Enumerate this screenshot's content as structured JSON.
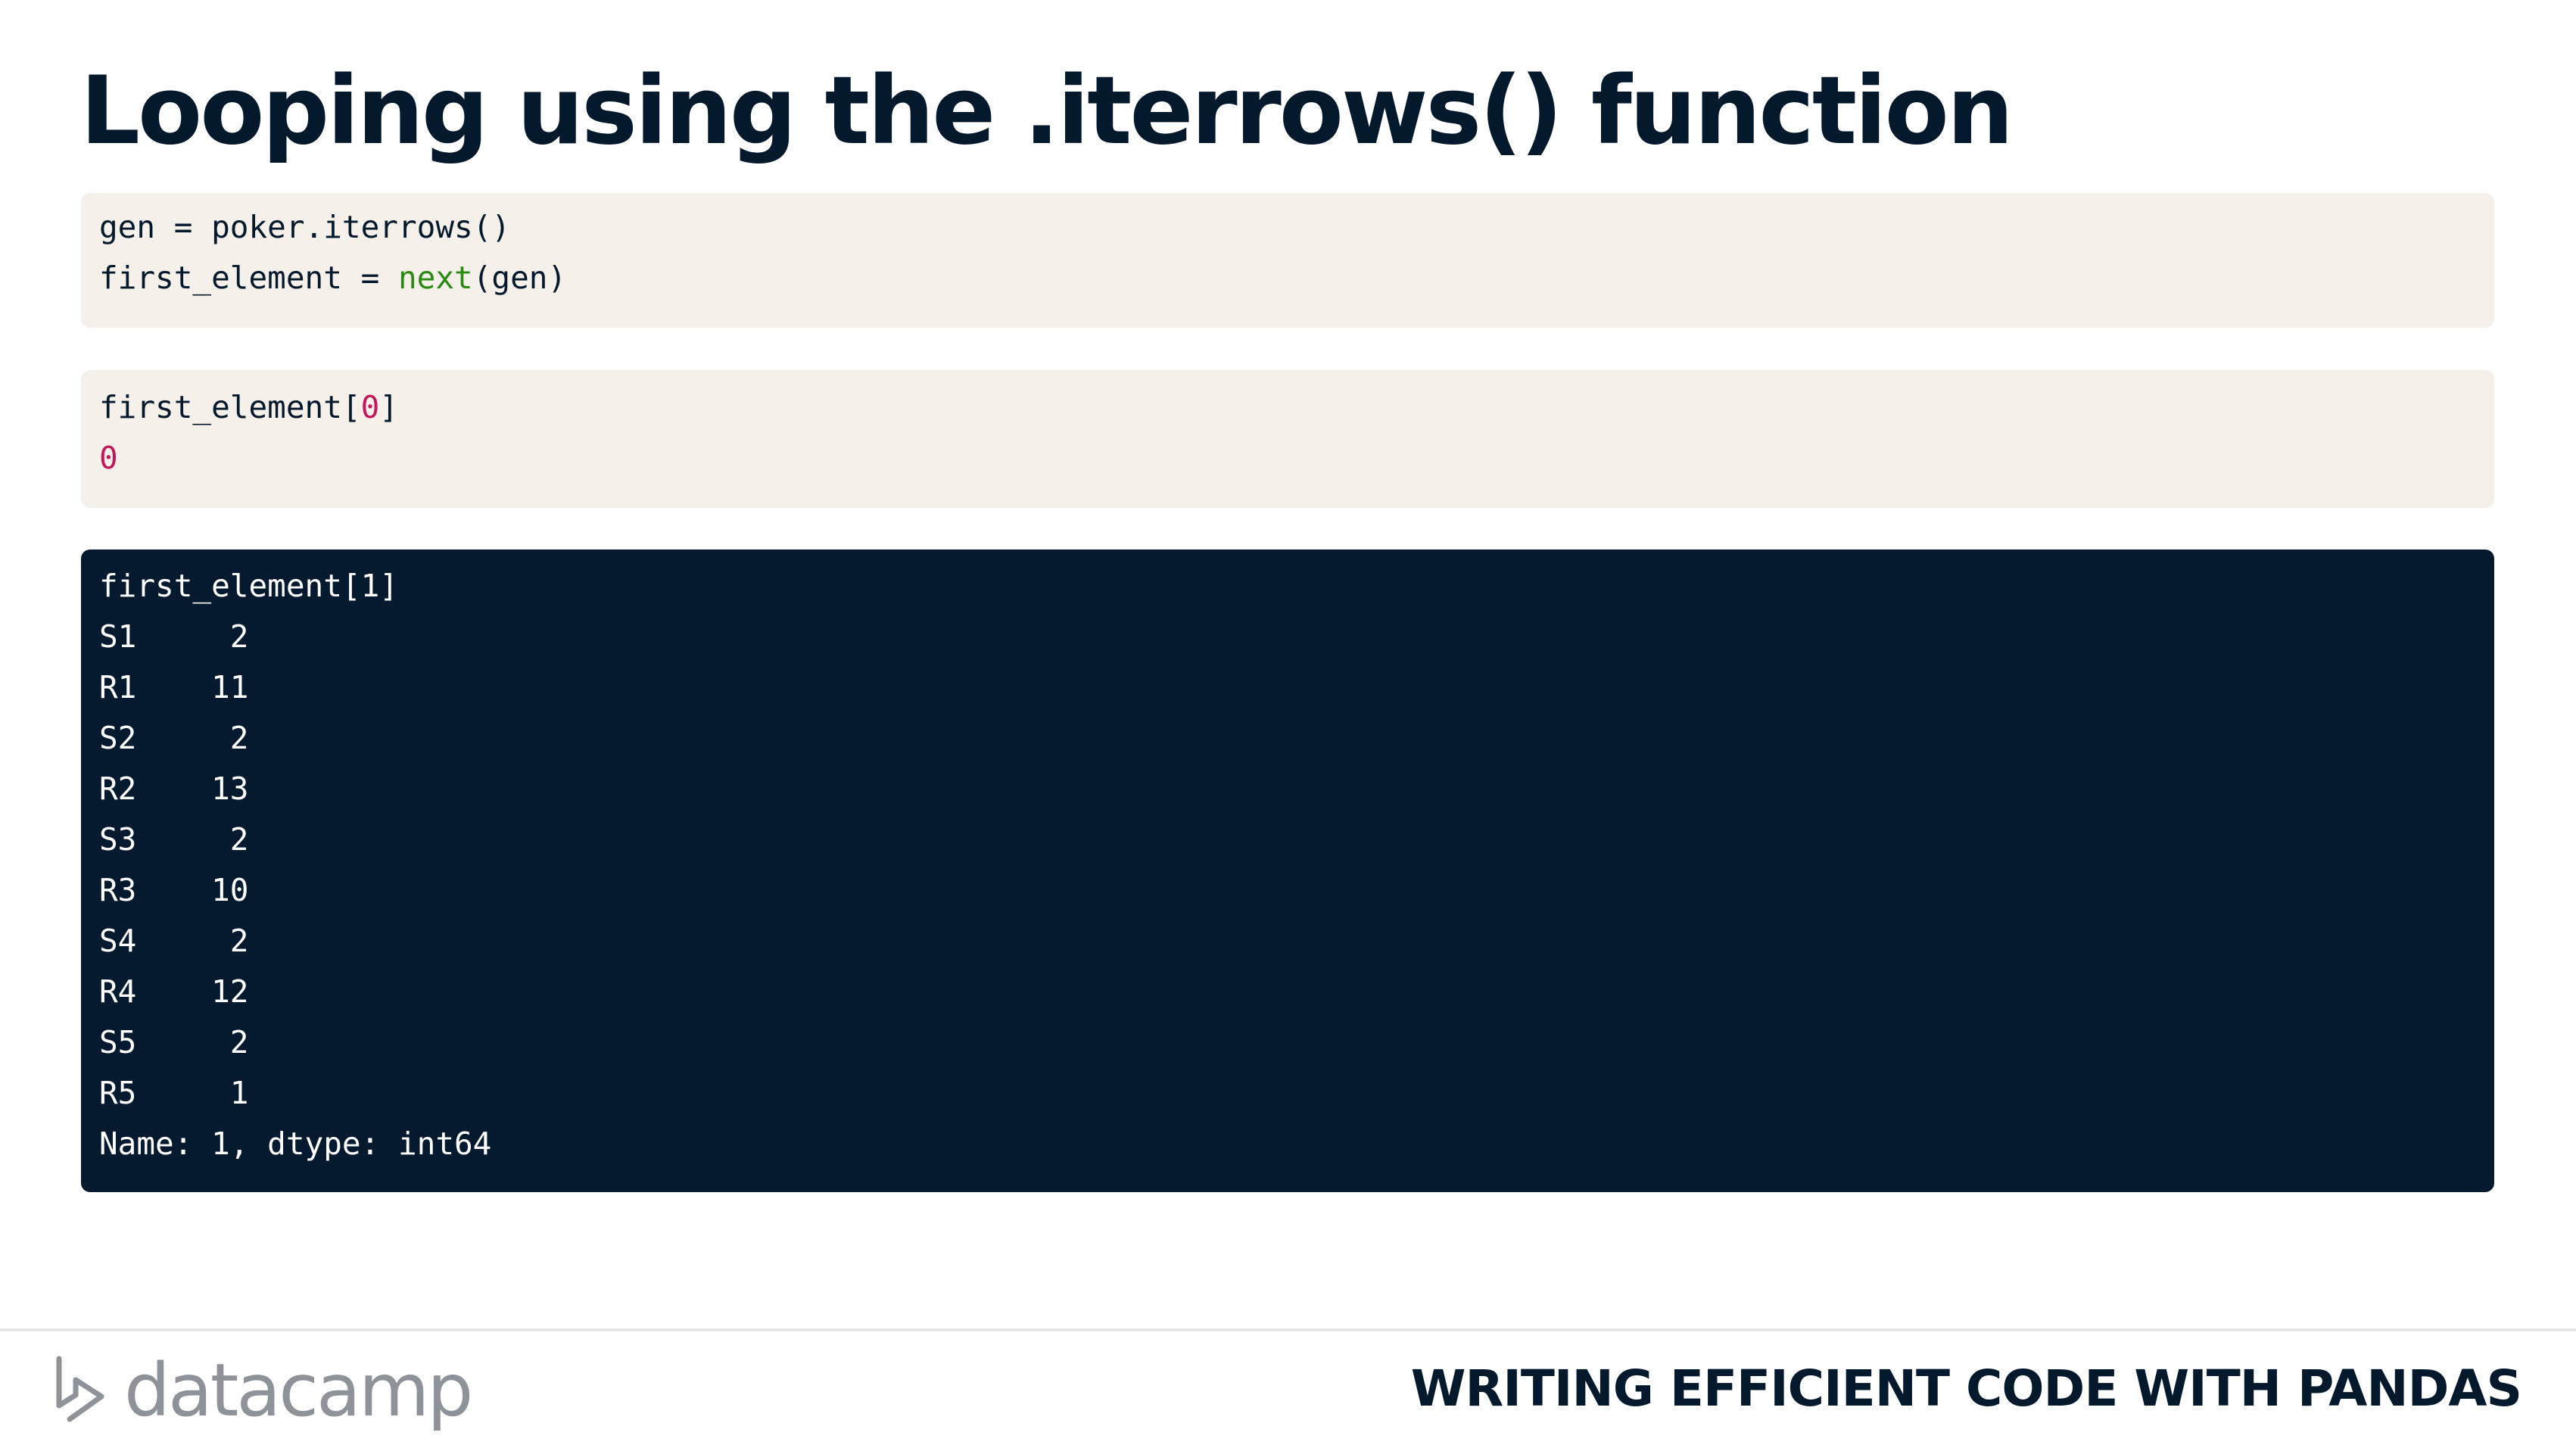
{
  "slide": {
    "title": "Looping using the .iterrows() function"
  },
  "code_blocks": [
    {
      "lines": [
        [
          {
            "text": "gen = poker.iterrows()"
          }
        ],
        [
          {
            "text": "first_element = "
          },
          {
            "text": "next",
            "style": "green"
          },
          {
            "text": "(gen)"
          }
        ]
      ]
    },
    {
      "lines": [
        [
          {
            "text": "first_element["
          },
          {
            "text": "0",
            "style": "pink"
          },
          {
            "text": "]"
          }
        ],
        [
          {
            "text": "0",
            "style": "pink"
          }
        ]
      ]
    },
    {
      "lines": [
        [
          {
            "text": "first_element[1]"
          }
        ],
        [
          {
            "text": "S1     2"
          }
        ],
        [
          {
            "text": "R1    11"
          }
        ],
        [
          {
            "text": "S2     2"
          }
        ],
        [
          {
            "text": "R2    13"
          }
        ],
        [
          {
            "text": "S3     2"
          }
        ],
        [
          {
            "text": "R3    10"
          }
        ],
        [
          {
            "text": "S4     2"
          }
        ],
        [
          {
            "text": "R4    12"
          }
        ],
        [
          {
            "text": "S5     2"
          }
        ],
        [
          {
            "text": "R5     1"
          }
        ],
        [
          {
            "text": "Name: 1, dtype: int64"
          }
        ]
      ]
    }
  ],
  "footer": {
    "logo_text": "datacamp",
    "logo_icon": "datacamp-logo-icon",
    "course_title": "WRITING EFFICIENT CODE WITH PANDAS"
  },
  "colors": {
    "title": "#05192d",
    "light_code_bg": "#f5f1ea",
    "dark_code_bg": "#051a2e",
    "keyword_green": "#2a8a14",
    "number_pink": "#c2185b",
    "logo_gray": "#8e9399"
  }
}
